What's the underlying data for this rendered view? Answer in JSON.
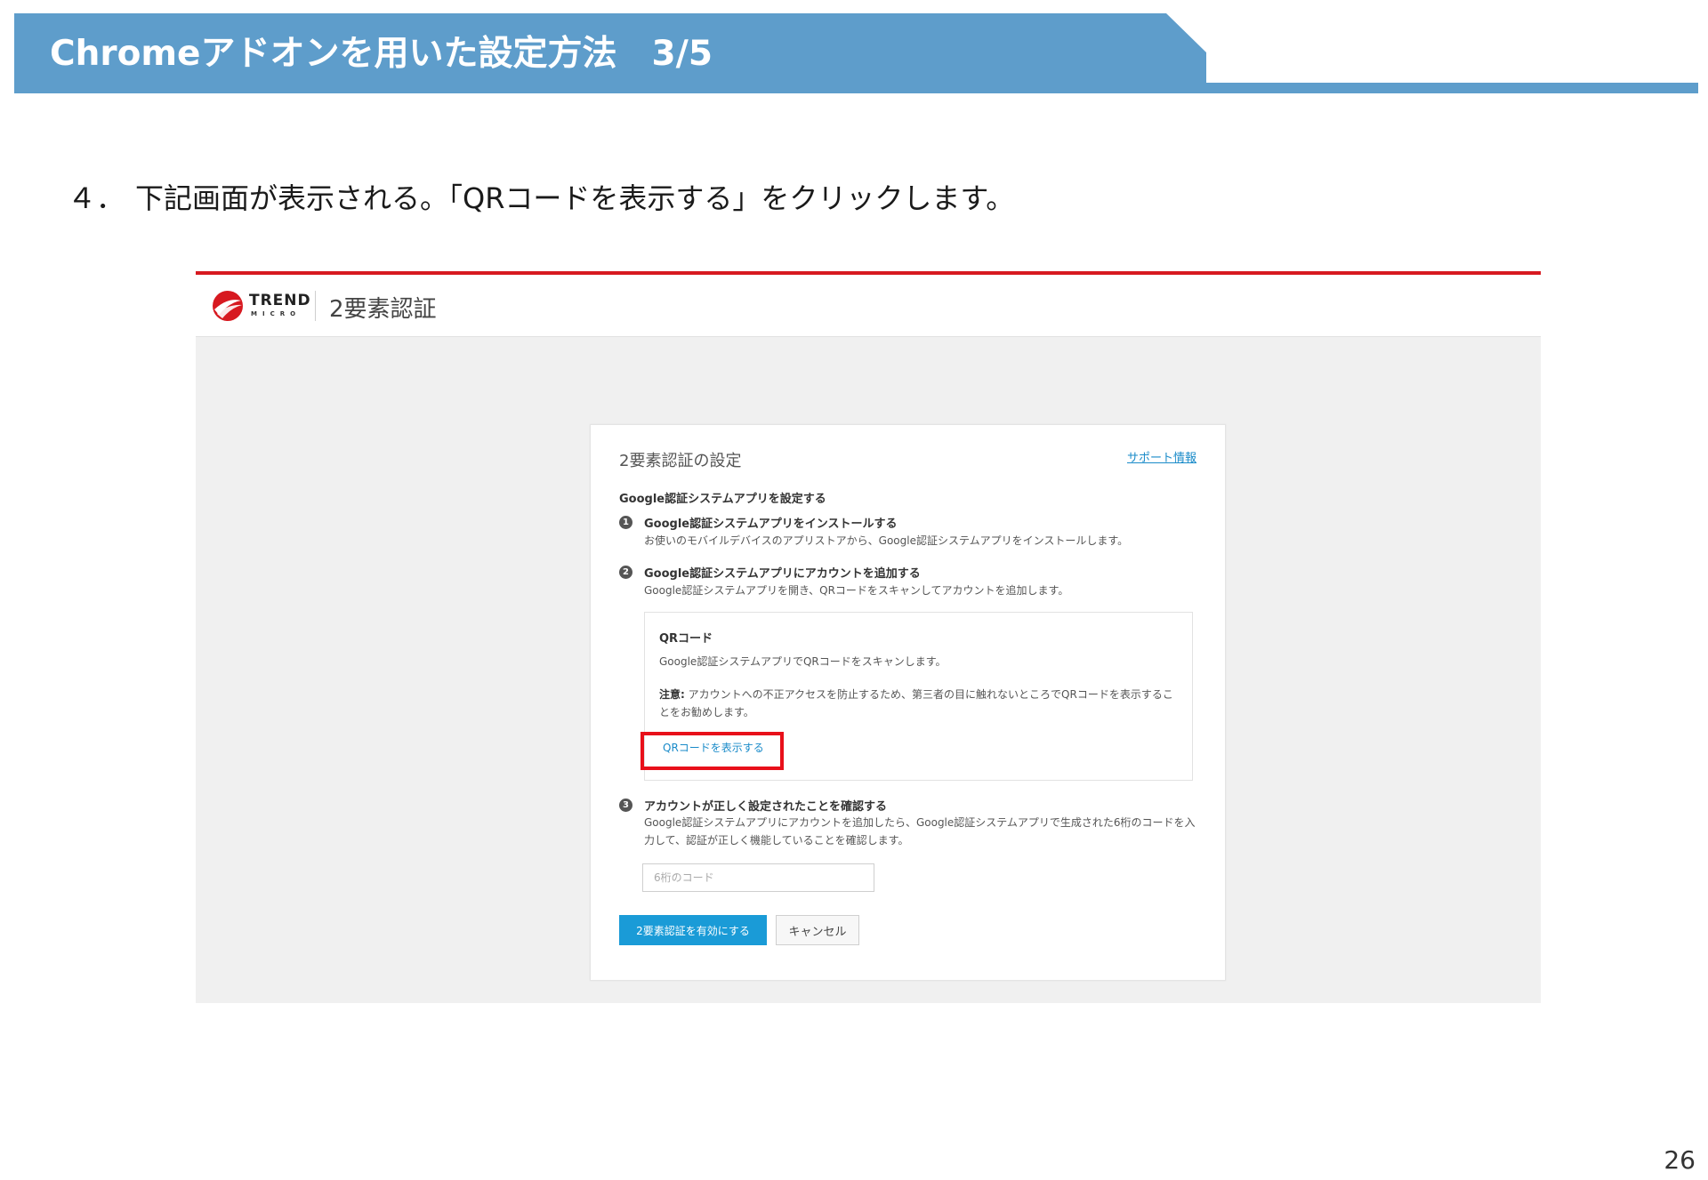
{
  "slide": {
    "title": "Chromeアドオンを用いた設定方法　3/5",
    "step_number": "４．",
    "instruction": "下記画面が表示される。「QRコードを表示する」をクリックします。",
    "page_number": "26",
    "accent_color": "#5e9dcb"
  },
  "screenshot": {
    "brand": {
      "name": "TREND",
      "sub": "MICRO",
      "icon": "trend-micro-logo-icon"
    },
    "app_title": "2要素認証",
    "card": {
      "title": "2要素認証の設定",
      "support_link": "サポート情報",
      "section_title": "Google認証システムアプリを設定する",
      "steps": [
        {
          "bullet": "1",
          "heading": "Google認証システムアプリをインストールする",
          "desc": "お使いのモバイルデバイスのアプリストアから、Google認証システムアプリをインストールします。"
        },
        {
          "bullet": "2",
          "heading": "Google認証システムアプリにアカウントを追加する",
          "desc": "Google認証システムアプリを開き、QRコードをスキャンしてアカウントを追加します。"
        },
        {
          "bullet": "3",
          "heading": "アカウントが正しく設定されたことを確認する",
          "desc": "Google認証システムアプリにアカウントを追加したら、Google認証システムアプリで生成された6桁のコードを入力して、認証が正しく機能していることを確認します。"
        }
      ],
      "qr": {
        "title": "QRコード",
        "desc": "Google認証システムアプリでQRコードをスキャンします。",
        "note_label": "注意:",
        "note_text": " アカウントへの不正アクセスを防止するため、第三者の目に触れないところでQRコードを表示することをお勧めします。",
        "show_link": "QRコードを表示する"
      },
      "code_placeholder": "6桁のコード",
      "enable_button": "2要素認証を有効にする",
      "cancel_button": "キャンセル"
    }
  }
}
